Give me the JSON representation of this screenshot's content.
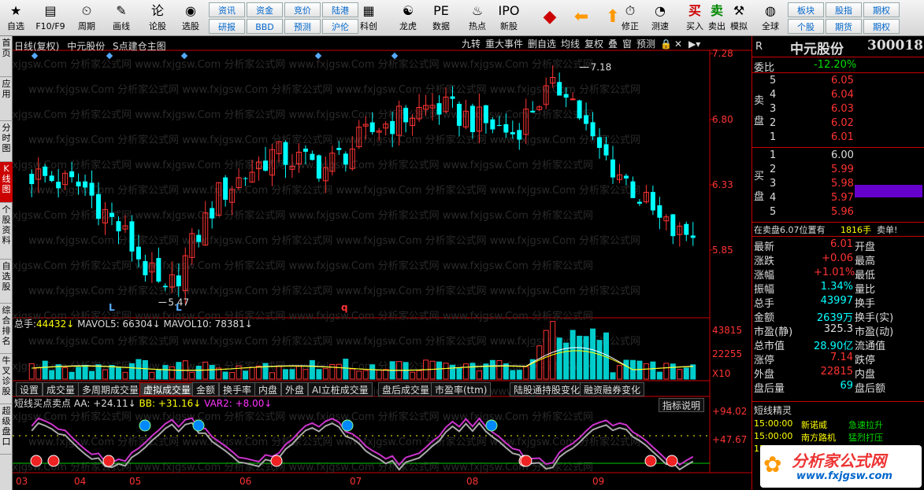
{
  "toolbar": {
    "buttons": [
      {
        "label": "自选",
        "icon": "star-icon"
      },
      {
        "label": "F10/F9",
        "icon": "f10-icon"
      },
      {
        "label": "周期",
        "icon": "clock-icon"
      },
      {
        "label": "画线",
        "icon": "pencil-icon"
      },
      {
        "label": "论股",
        "icon": "discuss-icon"
      },
      {
        "label": "选股",
        "icon": "select-icon"
      },
      {
        "label": "科创",
        "icon": "kechuang-icon"
      },
      {
        "label": "龙虎",
        "icon": "dragon-icon"
      },
      {
        "label": "数据",
        "icon": "pe-icon"
      },
      {
        "label": "热点",
        "icon": "hot-icon"
      },
      {
        "label": "新股",
        "icon": "ipo-icon"
      },
      {
        "label": "修正",
        "icon": "fix-icon"
      },
      {
        "label": "测速",
        "icon": "speed-icon"
      },
      {
        "label": "买入",
        "icon": "buy-icon"
      },
      {
        "label": "卖出",
        "icon": "sell-icon"
      },
      {
        "label": "模拟",
        "icon": "hammer-icon"
      },
      {
        "label": "全球",
        "icon": "globe-icon"
      }
    ],
    "tags": [
      "资讯",
      "资金",
      "竞价",
      "陆港",
      "研报",
      "BBD",
      "预测",
      "沪伦",
      "板块",
      "股指",
      "期权",
      "个股",
      "期货",
      "期权"
    ],
    "buy_glyph": "买",
    "sell_glyph": "卖"
  },
  "lefttabs": [
    "首页",
    "应用",
    "分时图",
    "K线图",
    "个股资料",
    "自选股",
    "综合排名",
    "牛叉诊股",
    "超级盘口"
  ],
  "chart": {
    "title": "日线(复权)",
    "stock": "中元股份",
    "mainfig": "S点建仓主图",
    "toptabs": [
      "九转",
      "重大事件",
      "删自选",
      "均线",
      "复权",
      "叠",
      "窗",
      "预测"
    ],
    "price_high": "7.18",
    "price_low": "5.47",
    "yaxis": [
      "7.28",
      "6.80",
      "6.33",
      "5.85"
    ],
    "vol_line": {
      "label": "总手:",
      "v": "44432",
      "ma5": "MAVOL5: 66304",
      "ma10": "MAVOL10: 78381"
    },
    "vol_yaxis": [
      "43815",
      "22255",
      "X10"
    ],
    "bottomtabs": [
      "设置",
      "成交量",
      "多周期成交量",
      "虚拟成交量",
      "金额",
      "换手率",
      "内盘",
      "外盘",
      "AI立桩成交量",
      "盘后成交量",
      "市盈率(ttm)",
      "陆股通持股变化",
      "融资融券变化"
    ],
    "ind_line": {
      "label": "短线买点卖点",
      "aa": "AA: +24.11",
      "bb": "BB: +31.16",
      "var2": "VAR2: +8.00"
    },
    "ind_yaxis": [
      "+94.02",
      "+47.67"
    ],
    "ind_btn": "指标说明",
    "months": [
      "03",
      "04",
      "05",
      "06",
      "07",
      "08",
      "09"
    ],
    "markers": [
      "L",
      "L",
      "q"
    ],
    "watermark": "www.fxjgsw.Com 分析家公式网"
  },
  "quote": {
    "tag": "R",
    "name": "中元股份",
    "code": "300018",
    "weibi_label": "委比",
    "weibi": "-12.20%",
    "sell_label": "卖盘",
    "buy_label": "买盘",
    "asks": [
      {
        "n": "5",
        "p": "6.05"
      },
      {
        "n": "4",
        "p": "6.04"
      },
      {
        "n": "3",
        "p": "6.03"
      },
      {
        "n": "2",
        "p": "6.02"
      },
      {
        "n": "1",
        "p": "6.01"
      }
    ],
    "bids": [
      {
        "n": "1",
        "p": "6.00"
      },
      {
        "n": "2",
        "p": "5.99"
      },
      {
        "n": "3",
        "p": "5.98"
      },
      {
        "n": "4",
        "p": "5.97"
      },
      {
        "n": "5",
        "p": "5.96"
      }
    ],
    "sellinfo": "在卖盘6.07位置有",
    "sellqty": "1816手",
    "selltxt": "卖单!",
    "stats": [
      {
        "a": "最新",
        "v": "6.01",
        "b": "开盘"
      },
      {
        "a": "涨跌",
        "v": "+0.06",
        "b": "最高"
      },
      {
        "a": "涨幅",
        "v": "+1.01%",
        "b": "最低"
      },
      {
        "a": "振幅",
        "v": "1.34%",
        "b": "量比"
      },
      {
        "a": "总手",
        "v": "43997",
        "b": "换手"
      },
      {
        "a": "金额",
        "v": "2639万",
        "b": "换手(实)"
      },
      {
        "a": "市盈(静)",
        "v": "325.3",
        "b": "市盈(动)"
      },
      {
        "a": "总市值",
        "v": "28.90亿",
        "b": "流通值"
      },
      {
        "a": "涨停",
        "v": "7.14",
        "b": "跌停"
      },
      {
        "a": "外盘",
        "v": "22815",
        "b": "内盘"
      },
      {
        "a": "盘后量",
        "v": "69",
        "b": "盘后额"
      }
    ],
    "jl_title": "短线精灵",
    "jl": [
      {
        "t": "15:00:00",
        "n": "新诺威",
        "e": "急速拉升"
      },
      {
        "t": "15:00:00",
        "n": "南方路机",
        "e": "猛烈打压"
      },
      {
        "t": "15:00:00",
        "n": "",
        "e": ""
      }
    ],
    "logo": "分析家公式网",
    "logo_url": "www.fxjgsw.com"
  }
}
